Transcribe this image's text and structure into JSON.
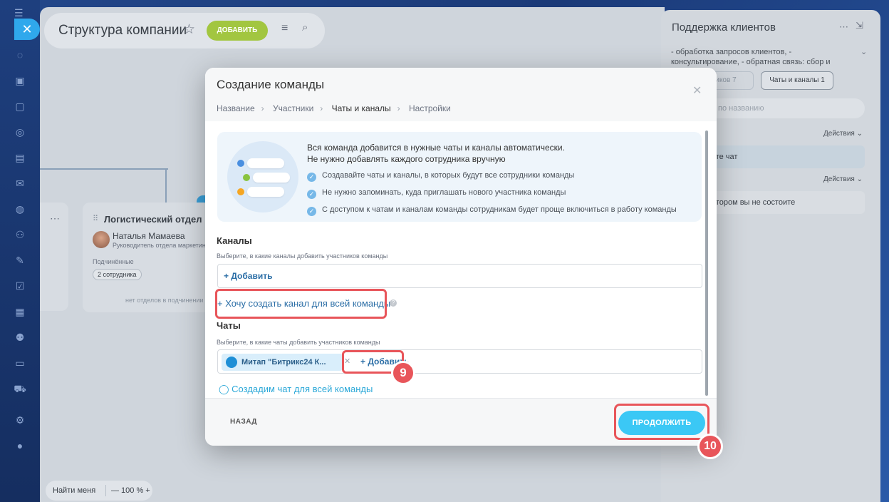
{
  "main": {
    "title": "Структура компании",
    "add_label": "ДОБАВИТЬ",
    "dept": {
      "title": "Логистический отдел",
      "person_name": "Наталья Мамаева",
      "person_role": "Руководитель отдела маркетинга",
      "sub_label": "Подчинённые",
      "sub_count": "2 сотрудника",
      "no_depts": "нет отделов в подчинении"
    },
    "zoom": {
      "find_label": "Найти меня",
      "value": "— 100 % +"
    }
  },
  "right_panel": {
    "title": "Поддержка клиентов",
    "desc": "- обработка запросов клиентов, - консультирование, - обратная связь: сбор и",
    "tab1_label": "дников",
    "tab1_count": "7",
    "tab2_label": "Чаты и каналы",
    "tab2_count": "1",
    "search_text": "по названию",
    "actions_label": "Действия",
    "row1_text": "вьте чат",
    "row2_text": "котором вы не состоите"
  },
  "modal": {
    "title": "Создание команды",
    "crumbs": [
      "Название",
      "Участники",
      "Чаты и каналы",
      "Настройки"
    ],
    "info": {
      "line1": "Вся команда добавится в нужные чаты и каналы автоматически.",
      "line2": "Не нужно добавлять каждого сотрудника вручную",
      "bullets": [
        "Создавайте чаты и каналы, в которых будут все сотрудники команды",
        "Не нужно запоминать, куда приглашать нового участника команды",
        "С доступом к чатам и каналам команды сотрудникам будет проще включиться в работу команды"
      ]
    },
    "channels": {
      "label": "Каналы",
      "hint": "Выберите, в какие каналы добавить участников команды",
      "add_label": "+ Добавить",
      "create_link": "+ Хочу создать канал для всей команды"
    },
    "chats": {
      "label": "Чаты",
      "hint": "Выберите, в какие чаты добавить участников команды",
      "chip_label": "Митап \"Битрикс24 К...",
      "add_label": "+ Добавить",
      "ok_line": "Создадим чат для всей команды"
    },
    "back_label": "НАЗАД",
    "continue_label": "ПРОДОЛЖИТЬ"
  },
  "steps": {
    "step9": "9",
    "step10": "10"
  },
  "colors": {
    "accent": "#3bc8f5",
    "highlight": "#e8555a",
    "add_green": "#a2c640"
  }
}
